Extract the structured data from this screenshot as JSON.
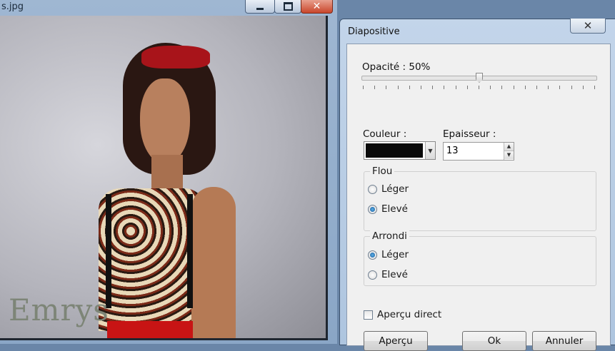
{
  "image_window": {
    "title": "s.jpg",
    "watermark": "Emrys"
  },
  "dialog": {
    "title": "Diapositive",
    "opacity": {
      "label": "Opacité : 50%",
      "value": 50
    },
    "color": {
      "label": "Couleur :",
      "value": "#0a0a0a"
    },
    "thickness": {
      "label": "Epaisseur :",
      "value": "13"
    },
    "flou": {
      "title": "Flou",
      "options": [
        "Léger",
        "Elevé"
      ],
      "selected": "Elevé"
    },
    "arrondi": {
      "title": "Arrondi",
      "options": [
        "Léger",
        "Elevé"
      ],
      "selected": "Léger"
    },
    "live_preview": {
      "label": "Aperçu direct",
      "checked": false
    },
    "buttons": {
      "preview": "Aperçu",
      "ok": "Ok",
      "cancel": "Annuler"
    }
  },
  "colors": {
    "accent_radio": "#1a5a9a",
    "titlebar": "#aec5df",
    "close_button": "#c9462b"
  }
}
